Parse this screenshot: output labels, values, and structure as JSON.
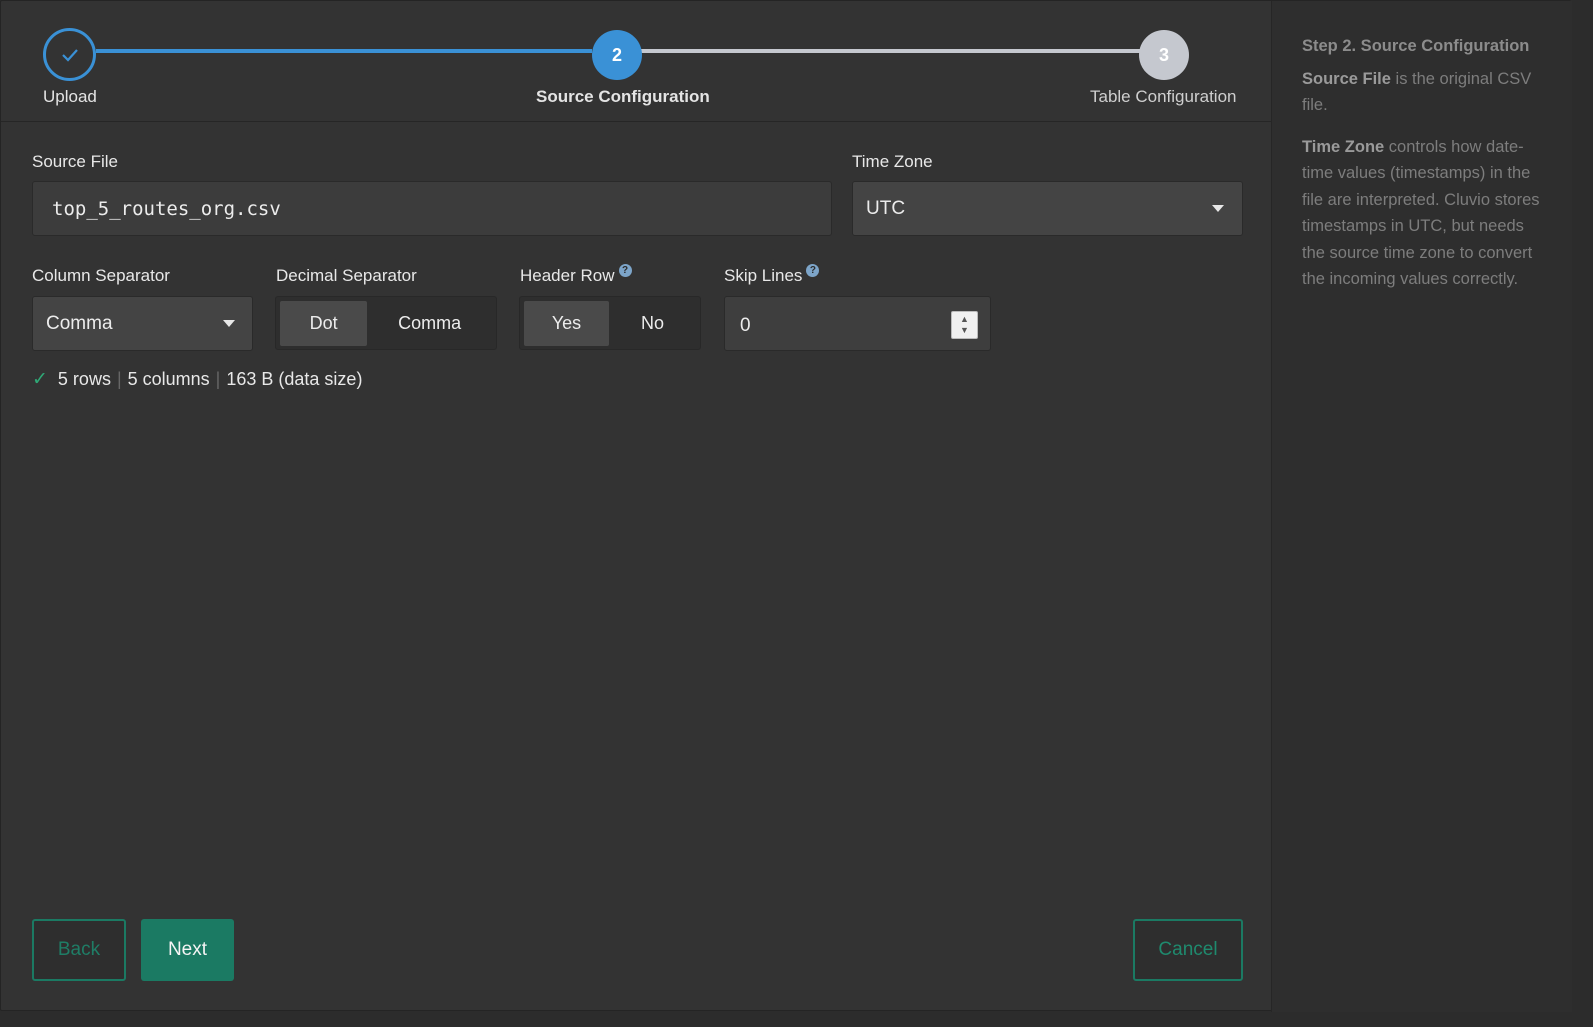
{
  "stepper": {
    "steps": [
      {
        "number": "",
        "label": "Upload",
        "state": "done"
      },
      {
        "number": "2",
        "label": "Source Configuration",
        "state": "active"
      },
      {
        "number": "3",
        "label": "Table Configuration",
        "state": "pending"
      }
    ]
  },
  "form": {
    "source_file_label": "Source File",
    "source_file_value": "top_5_routes_org.csv",
    "time_zone_label": "Time Zone",
    "time_zone_value": "UTC",
    "column_separator_label": "Column Separator",
    "column_separator_value": "Comma",
    "decimal_separator_label": "Decimal Separator",
    "decimal_options": [
      "Dot",
      "Comma"
    ],
    "decimal_selected": "Dot",
    "header_row_label": "Header Row",
    "header_options": [
      "Yes",
      "No"
    ],
    "header_selected": "Yes",
    "skip_lines_label": "Skip Lines",
    "skip_lines_value": "0",
    "help_icon": "?"
  },
  "stats": {
    "rows": "5 rows",
    "columns": "5 columns",
    "size": "163 B (data size)",
    "separator": "|"
  },
  "buttons": {
    "back": "Back",
    "next": "Next",
    "cancel": "Cancel"
  },
  "help": {
    "title": "Step 2. Source Configuration",
    "p1_bold": "Source File",
    "p1_text": " is the original CSV file.",
    "p2_bold": "Time Zone",
    "p2_text": " controls how date-time values (timestamps) in the file are interpreted. Cluvio stores timestamps in UTC, but needs the source time zone to convert the incoming values correctly."
  },
  "colors": {
    "accent_blue": "#3a91d6",
    "accent_green": "#1b7a63",
    "success": "#2fa876"
  }
}
